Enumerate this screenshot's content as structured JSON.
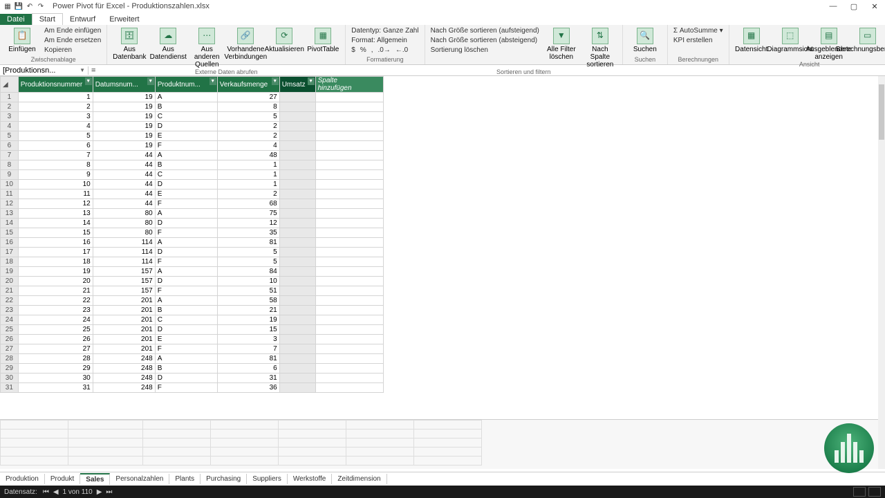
{
  "window": {
    "title": "Power Pivot für Excel - Produktionszahlen.xlsx"
  },
  "menutabs": {
    "file": "Datei",
    "items": [
      "Start",
      "Entwurf",
      "Erweitert"
    ],
    "active": 0
  },
  "ribbon": {
    "clipboard": {
      "paste": "Einfügen",
      "append": "Am Ende einfügen",
      "replace": "Am Ende ersetzen",
      "copy": "Kopieren",
      "label": "Zwischenablage"
    },
    "external": {
      "db": "Aus Datenbank",
      "ds": "Aus Datendienst",
      "other": "Aus anderen Quellen",
      "existing": "Vorhandene Verbindungen",
      "refresh": "Aktualisieren",
      "pivot": "PivotTable",
      "label": "Externe Daten abrufen"
    },
    "format": {
      "datatype": "Datentyp: Ganze Zahl",
      "fmt": "Format: Allgemein",
      "label": "Formatierung"
    },
    "sort": {
      "asc": "Nach Größe sortieren (aufsteigend)",
      "desc": "Nach Größe sortieren (absteigend)",
      "clear": "Sortierung löschen",
      "allfilter": "Alle Filter löschen",
      "bycol": "Nach Spalte sortieren",
      "label": "Sortieren und filtern"
    },
    "find": {
      "search": "Suchen",
      "label": "Suchen"
    },
    "calc": {
      "autosum": "AutoSumme",
      "kpi": "KPI erstellen",
      "label": "Berechnungen"
    },
    "view": {
      "dataview": "Datensicht",
      "diagview": "Diagrammsicht",
      "hidden": "Ausgeblendete anzeigen",
      "calcarea": "Berechnungsbereich",
      "label": "Ansicht"
    }
  },
  "formulabar": {
    "name": "[Produktionsn...",
    "value": "="
  },
  "columns": [
    "Produktionsnummer",
    "Datumsnum...",
    "Produktnum...",
    "Verkaufsmenge",
    "Umsatz"
  ],
  "addcol": "Spalte hinzufügen",
  "rows": [
    [
      1,
      19,
      "A",
      27
    ],
    [
      2,
      19,
      "B",
      8
    ],
    [
      3,
      19,
      "C",
      5
    ],
    [
      4,
      19,
      "D",
      2
    ],
    [
      5,
      19,
      "E",
      2
    ],
    [
      6,
      19,
      "F",
      4
    ],
    [
      7,
      44,
      "A",
      48
    ],
    [
      8,
      44,
      "B",
      1
    ],
    [
      9,
      44,
      "C",
      1
    ],
    [
      10,
      44,
      "D",
      1
    ],
    [
      11,
      44,
      "E",
      2
    ],
    [
      12,
      44,
      "F",
      68
    ],
    [
      13,
      80,
      "A",
      75
    ],
    [
      14,
      80,
      "D",
      12
    ],
    [
      15,
      80,
      "F",
      35
    ],
    [
      16,
      114,
      "A",
      81
    ],
    [
      17,
      114,
      "D",
      5
    ],
    [
      18,
      114,
      "F",
      5
    ],
    [
      19,
      157,
      "A",
      84
    ],
    [
      20,
      157,
      "D",
      10
    ],
    [
      21,
      157,
      "F",
      51
    ],
    [
      22,
      201,
      "A",
      58
    ],
    [
      23,
      201,
      "B",
      21
    ],
    [
      24,
      201,
      "C",
      19
    ],
    [
      25,
      201,
      "D",
      15
    ],
    [
      26,
      201,
      "E",
      3
    ],
    [
      27,
      201,
      "F",
      7
    ],
    [
      28,
      248,
      "A",
      81
    ],
    [
      29,
      248,
      "B",
      6
    ],
    [
      30,
      248,
      "D",
      31
    ],
    [
      31,
      248,
      "F",
      36
    ]
  ],
  "sheets": [
    "Produktion",
    "Produkt",
    "Sales",
    "Personalzahlen",
    "Plants",
    "Purchasing",
    "Suppliers",
    "Werkstoffe",
    "Zeitdimension"
  ],
  "active_sheet": 2,
  "status": {
    "record": "Datensatz:",
    "pos": "1 von 110"
  }
}
